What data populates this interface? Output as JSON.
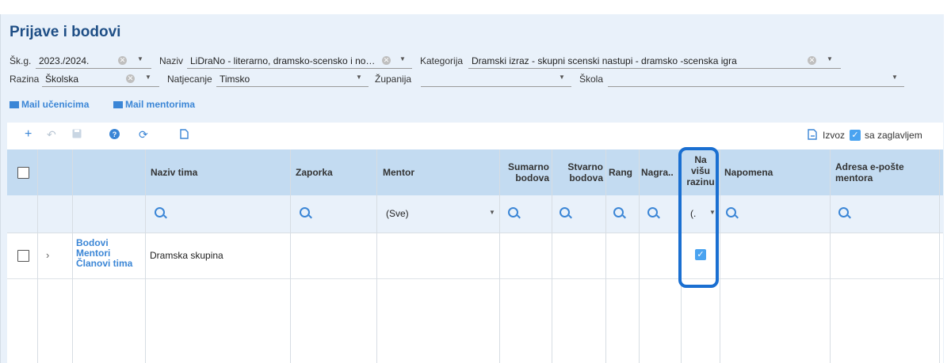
{
  "page": {
    "title": "Prijave i bodovi"
  },
  "filters": {
    "skg": {
      "label": "Šk.g.",
      "value": "2023./2024."
    },
    "naziv": {
      "label": "Naziv",
      "value": "LiDraNo - literarno, dramsko-scensko i novi..."
    },
    "kategorija": {
      "label": "Kategorija",
      "value": "Dramski izraz - skupni scenski nastupi - dramsko -scenska igra"
    },
    "razina": {
      "label": "Razina",
      "value": "Školska"
    },
    "natjecanje": {
      "label": "Natjecanje",
      "value": "Timsko"
    },
    "zupanija": {
      "label": "Županija",
      "value": ""
    },
    "skola": {
      "label": "Škola",
      "value": ""
    }
  },
  "mail": {
    "ucenicima": "Mail učenicima",
    "mentorima": "Mail mentorima"
  },
  "toolbar": {
    "export_label": "Izvoz",
    "with_header_label": "sa zaglavljem",
    "with_header_checked": true
  },
  "grid": {
    "columns": {
      "naziv_tima": "Naziv tima",
      "zaporka": "Zaporka",
      "mentor": "Mentor",
      "sumarno_1": "Sumarno",
      "sumarno_2": "bodova",
      "stvarno_1": "Stvarno",
      "stvarno_2": "bodova",
      "rang": "Rang",
      "nagrada": "Nagra..",
      "na_visu_1": "Na",
      "na_visu_2": "višu",
      "na_visu_3": "razinu",
      "napomena": "Napomena",
      "adresa_1": "Adresa e-pošte",
      "adresa_2": "mentora"
    },
    "filter_mentor": "(Sve)",
    "filter_na_visu": "(.",
    "row": {
      "links": [
        "Bodovi",
        "Mentori",
        "Članovi tima"
      ],
      "naziv_tima": "Dramska skupina",
      "na_visu_checked": true
    }
  },
  "colors": {
    "accent": "#3b86d6",
    "header_bg": "#c3dbf1",
    "panel_bg": "#e9f1fa",
    "title": "#1f4f86",
    "highlight": "#1a6fd1"
  }
}
